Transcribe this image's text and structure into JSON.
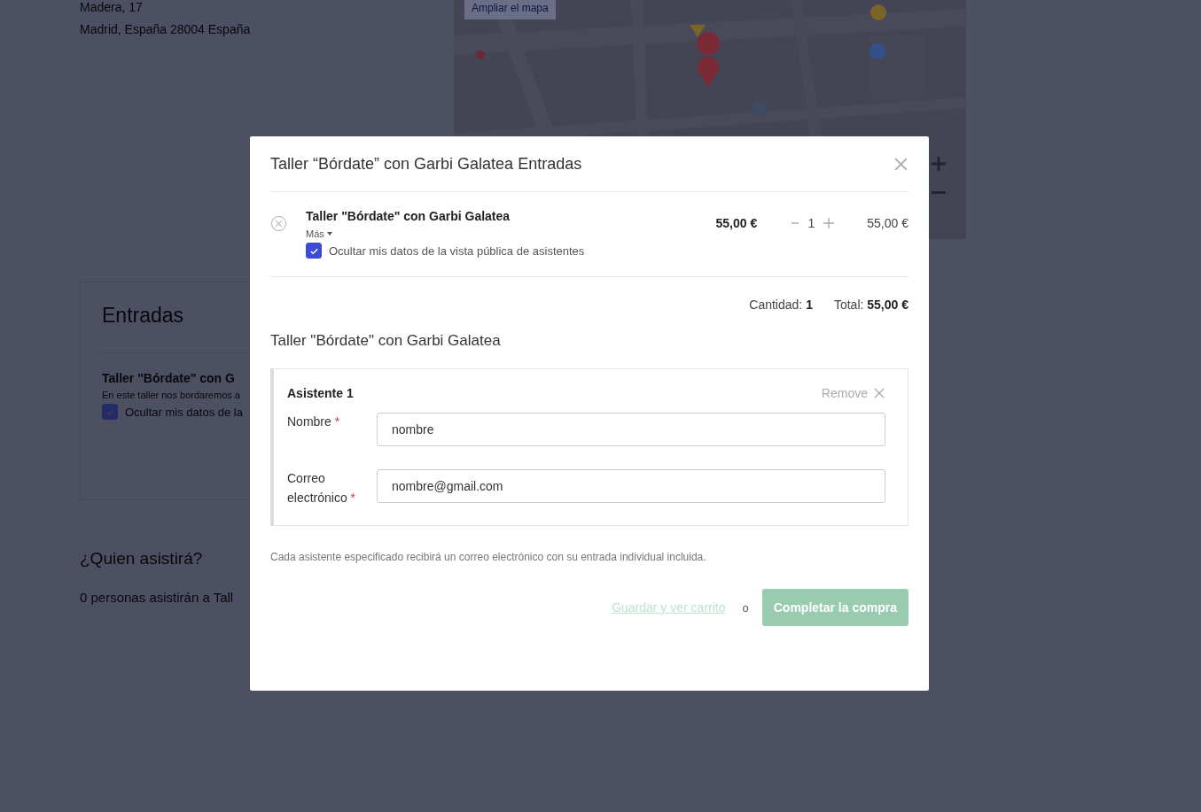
{
  "background": {
    "address_lines": [
      "Madera, 17",
      "Madrid, España 28004 España"
    ],
    "map": {
      "link": "Ampliar el mapa"
    },
    "tickets_card": {
      "title": "Entradas",
      "ticket_name": "Taller \"Bórdate\" con G",
      "description": "En este taller nos bordaremos a",
      "hide_data": {
        "label": "Ocultar mis datos de la",
        "checked": true
      }
    },
    "attendees_heading": "¿Quien asistirá?",
    "attendees_text": "0 personas asistirán a Tall"
  },
  "modal": {
    "title": "Taller “Bórdate” con Garbi Galatea Entradas",
    "items": [
      {
        "name": "Taller \"Bórdate\" con Garbi Galatea",
        "more": "Más",
        "hide_data": {
          "label": "Ocultar mis datos de la vista pública de asistentes",
          "checked": true
        },
        "price": "55,00 €",
        "quantity": "1",
        "subtotal": "55,00 €"
      }
    ],
    "summary": {
      "quantity_label": "Cantidad:",
      "quantity": "1",
      "total_label": "Total:",
      "total": "55,00 €"
    },
    "section_title": "Taller \"Bórdate\" con Garbi Galatea",
    "attendees": [
      {
        "title": "Asistente 1",
        "remove": "Remove",
        "fields": [
          {
            "label": "Nombre",
            "required_mark": "*",
            "value": "nombre"
          },
          {
            "label": "Correo electrónico",
            "required_mark": "*",
            "value": "nombre@gmail.com"
          }
        ]
      }
    ],
    "note": "Cada asistente especificado recibirá un correo electrónico con su entrada individual incluida.",
    "save_link": "Guardar y ver carrito",
    "separator": "o",
    "submit": {
      "label": "Completar la compra",
      "disabled": true
    }
  }
}
